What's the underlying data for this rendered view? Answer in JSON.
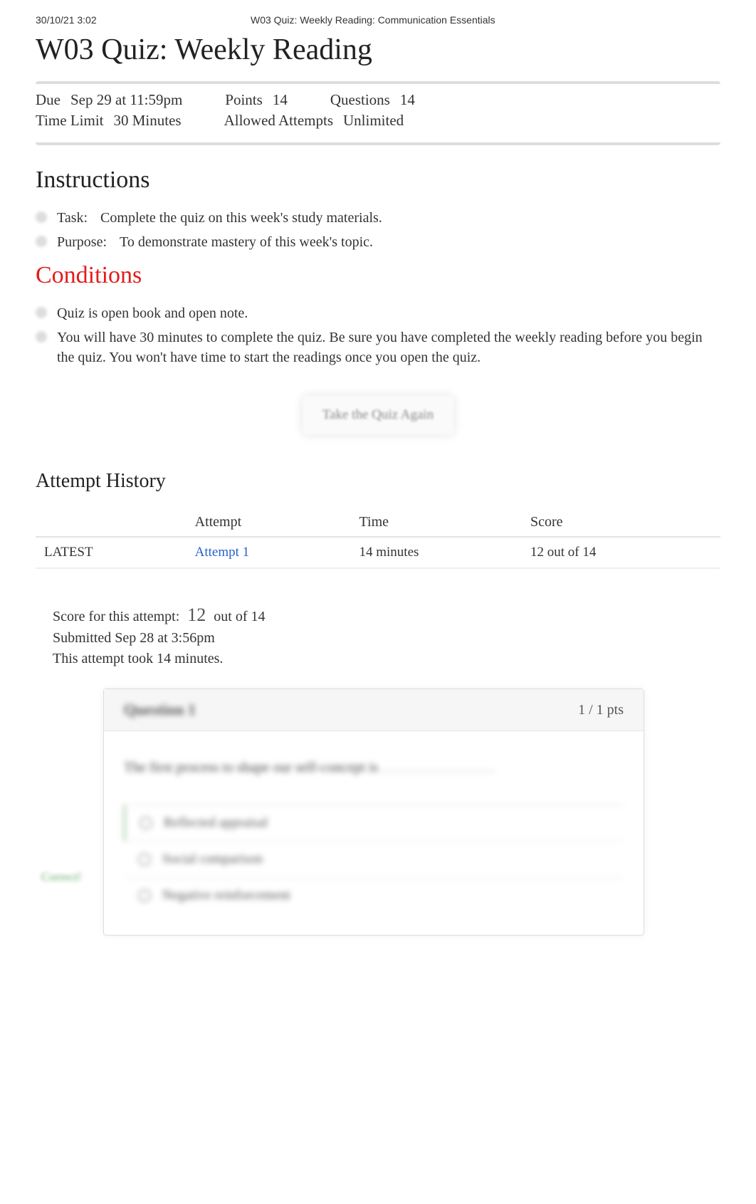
{
  "header": {
    "timestamp": "30/10/21 3:02",
    "doc_title": "W03 Quiz: Weekly Reading: Communication Essentials"
  },
  "title": "W03 Quiz: Weekly Reading",
  "meta": {
    "due_label": "Due",
    "due_value": "Sep 29 at 11:59pm",
    "points_label": "Points",
    "points_value": "14",
    "questions_label": "Questions",
    "questions_value": "14",
    "timelimit_label": "Time Limit",
    "timelimit_value": "30 Minutes",
    "attempts_label": "Allowed Attempts",
    "attempts_value": "Unlimited"
  },
  "instructions": {
    "heading": "Instructions",
    "items": [
      {
        "label": "Task:",
        "text": "Complete the quiz on this week's study materials."
      },
      {
        "label": "Purpose:",
        "text": "To demonstrate mastery of this week's topic."
      }
    ]
  },
  "conditions": {
    "heading": "Conditions",
    "items": [
      {
        "text": "Quiz is open book and open note."
      },
      {
        "text": "You will have 30 minutes to complete the quiz. Be sure you have completed the weekly reading before you begin the quiz. You won't have time to start the readings once you open the quiz."
      }
    ]
  },
  "take_again": "Take the Quiz Again",
  "history": {
    "heading": "Attempt History",
    "cols": [
      "",
      "Attempt",
      "Time",
      "Score"
    ],
    "rows": [
      {
        "latest": "LATEST",
        "attempt": "Attempt 1",
        "time": "14 minutes",
        "score": "12 out of 14"
      }
    ]
  },
  "score_section": {
    "label": "Score for this attempt:",
    "score": "12",
    "suffix": "out of 14",
    "submitted": "Submitted Sep 28 at 3:56pm",
    "took": "This attempt took 14 minutes."
  },
  "question1": {
    "title": "Question 1",
    "pts": "1 / 1 pts",
    "text": "The first process to shape our self-concept is",
    "correct_label": "Correct!",
    "answers": [
      "Reflected appraisal",
      "Social comparison",
      "Negative reinforcement"
    ]
  }
}
